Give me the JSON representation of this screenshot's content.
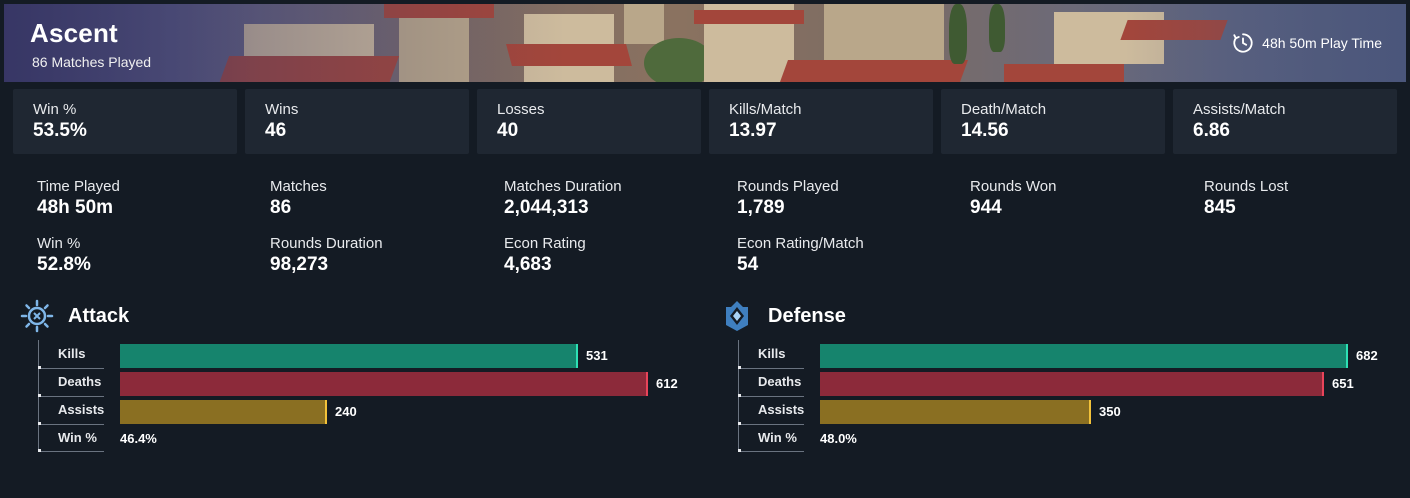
{
  "map": {
    "name": "Ascent",
    "matches_played": "86 Matches Played",
    "play_time": "48h 50m Play Time"
  },
  "tiles": [
    {
      "label": "Win %",
      "value": "53.5%"
    },
    {
      "label": "Wins",
      "value": "46"
    },
    {
      "label": "Losses",
      "value": "40"
    },
    {
      "label": "Kills/Match",
      "value": "13.97"
    },
    {
      "label": "Death/Match",
      "value": "14.56"
    },
    {
      "label": "Assists/Match",
      "value": "6.86"
    }
  ],
  "stats": [
    {
      "label": "Time Played",
      "value": "48h 50m"
    },
    {
      "label": "Matches",
      "value": "86"
    },
    {
      "label": "Matches Duration",
      "value": "2,044,313"
    },
    {
      "label": "Rounds Played",
      "value": "1,789"
    },
    {
      "label": "Rounds Won",
      "value": "944"
    },
    {
      "label": "Rounds Lost",
      "value": "845"
    },
    {
      "label": "Win %",
      "value": "52.8%"
    },
    {
      "label": "Rounds Duration",
      "value": "98,273"
    },
    {
      "label": "Econ Rating",
      "value": "4,683"
    },
    {
      "label": "Econ Rating/Match",
      "value": "54"
    }
  ],
  "colors": {
    "kills": "#16846d",
    "kills_cap": "#2ee0b4",
    "deaths": "#8c2a3a",
    "deaths_cap": "#e8445a",
    "assists": "#8a6f22",
    "assists_cap": "#f2c23a"
  },
  "attack": {
    "title": "Attack",
    "icon": "attack-sun-icon",
    "labels": {
      "kills": "Kills",
      "deaths": "Deaths",
      "assists": "Assists",
      "win": "Win %"
    },
    "kills": "531",
    "deaths": "612",
    "assists": "240",
    "win": "46.4%"
  },
  "defense": {
    "title": "Defense",
    "icon": "defense-shield-icon",
    "labels": {
      "kills": "Kills",
      "deaths": "Deaths",
      "assists": "Assists",
      "win": "Win %"
    },
    "kills": "682",
    "deaths": "651",
    "assists": "350",
    "win": "48.0%"
  }
}
